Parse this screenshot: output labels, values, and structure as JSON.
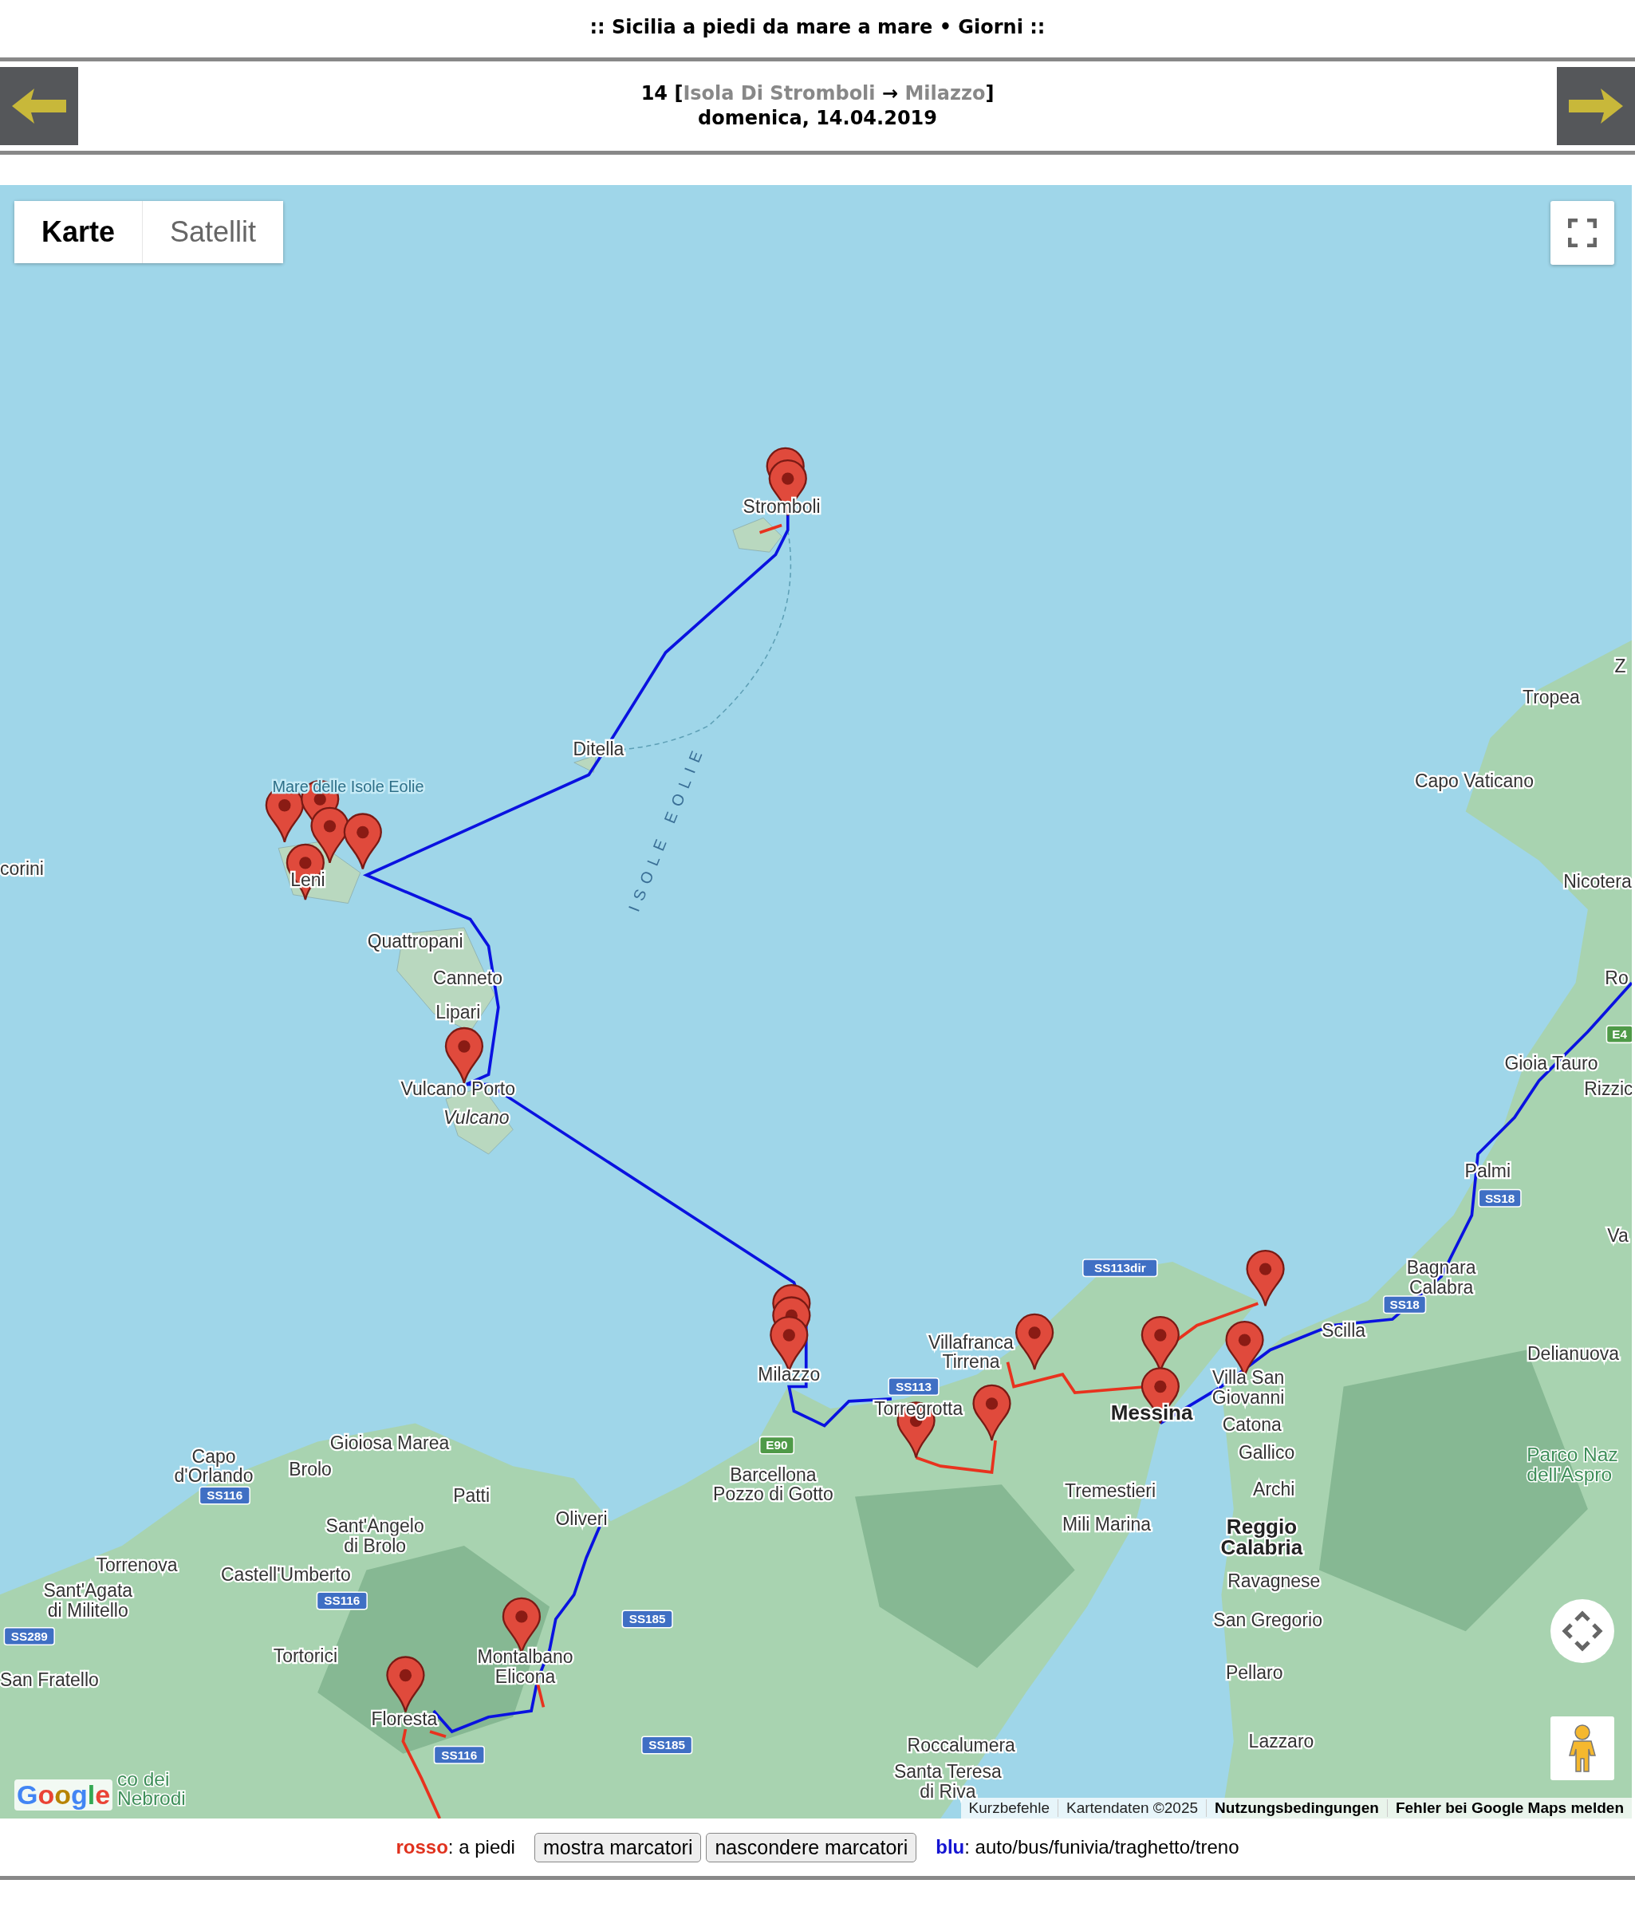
{
  "page_title": ":: Sicilia a piedi da mare a mare • Giorni ::",
  "day_nav": {
    "day_number": "14",
    "open_bracket": "[",
    "from": "Isola Di Stromboli",
    "arrow": "→",
    "to": "Milazzo",
    "close_bracket": "]",
    "date": "domenica, 14.04.2019"
  },
  "map": {
    "map_type_tabs": [
      {
        "label": "Karte",
        "selected": true
      },
      {
        "label": "Satellit",
        "selected": false
      }
    ],
    "labels": [
      {
        "lines": [
          "Stromboli"
        ],
        "kind": "place"
      },
      {
        "lines": [
          "Z"
        ],
        "kind": "place"
      },
      {
        "lines": [
          "Tropea"
        ],
        "kind": "place"
      },
      {
        "lines": [
          "Ditella"
        ],
        "kind": "place"
      },
      {
        "lines": [
          "Mare delle Isole Eolie"
        ],
        "kind": "water"
      },
      {
        "lines": [
          "Capo Vaticano"
        ],
        "kind": "place"
      },
      {
        "lines": [
          "ISOLE EOLIE"
        ],
        "kind": "archipelago"
      },
      {
        "lines": [
          "corini"
        ],
        "kind": "place"
      },
      {
        "lines": [
          "Leni"
        ],
        "kind": "place"
      },
      {
        "lines": [
          "Nicotera"
        ],
        "kind": "place"
      },
      {
        "lines": [
          "Quattropani"
        ],
        "kind": "place"
      },
      {
        "lines": [
          "Canneto"
        ],
        "kind": "place"
      },
      {
        "lines": [
          "Ro"
        ],
        "kind": "place"
      },
      {
        "lines": [
          "Lipari"
        ],
        "kind": "place"
      },
      {
        "lines": [
          "Gioia Tauro"
        ],
        "kind": "place"
      },
      {
        "lines": [
          "Vulcano Porto"
        ],
        "kind": "place"
      },
      {
        "lines": [
          "Rizzic"
        ],
        "kind": "place"
      },
      {
        "lines": [
          "Vulcano"
        ],
        "kind": "island"
      },
      {
        "lines": [
          "Palmi"
        ],
        "kind": "place"
      },
      {
        "lines": [
          "Va"
        ],
        "kind": "place"
      },
      {
        "lines": [
          "Bagnara",
          "Calabra"
        ],
        "kind": "place"
      },
      {
        "lines": [
          "Scilla"
        ],
        "kind": "place"
      },
      {
        "lines": [
          "Villafranca",
          "Tirrena"
        ],
        "kind": "place"
      },
      {
        "lines": [
          "Delianuova"
        ],
        "kind": "place"
      },
      {
        "lines": [
          "Milazzo"
        ],
        "kind": "place"
      },
      {
        "lines": [
          "Villa San",
          "Giovanni"
        ],
        "kind": "place"
      },
      {
        "lines": [
          "Torregrotta"
        ],
        "kind": "place"
      },
      {
        "lines": [
          "Messina"
        ],
        "kind": "city"
      },
      {
        "lines": [
          "Catona"
        ],
        "kind": "place"
      },
      {
        "lines": [
          "Gioiosa Marea"
        ],
        "kind": "place"
      },
      {
        "lines": [
          "Capo",
          "d'Orlando"
        ],
        "kind": "place"
      },
      {
        "lines": [
          "Brolo"
        ],
        "kind": "place"
      },
      {
        "lines": [
          "Gallico"
        ],
        "kind": "place"
      },
      {
        "lines": [
          "Patti"
        ],
        "kind": "place"
      },
      {
        "lines": [
          "Barcellona",
          "Pozzo di Gotto"
        ],
        "kind": "place"
      },
      {
        "lines": [
          "Tremestieri"
        ],
        "kind": "place"
      },
      {
        "lines": [
          "Archi"
        ],
        "kind": "place"
      },
      {
        "lines": [
          "Parco Naz",
          "dell'Aspro"
        ],
        "kind": "park"
      },
      {
        "lines": [
          "Sant'Angelo",
          "di Brolo"
        ],
        "kind": "place"
      },
      {
        "lines": [
          "Oliveri"
        ],
        "kind": "place"
      },
      {
        "lines": [
          "Mili Marina"
        ],
        "kind": "place"
      },
      {
        "lines": [
          "Reggio",
          "Calabria"
        ],
        "kind": "city"
      },
      {
        "lines": [
          "Torrenova"
        ],
        "kind": "place"
      },
      {
        "lines": [
          "Castell'Umberto"
        ],
        "kind": "place"
      },
      {
        "lines": [
          "Ravagnese"
        ],
        "kind": "place"
      },
      {
        "lines": [
          "Sant'Agata",
          "di Militello"
        ],
        "kind": "place"
      },
      {
        "lines": [
          "San Gregorio"
        ],
        "kind": "place"
      },
      {
        "lines": [
          "Tortorici"
        ],
        "kind": "place"
      },
      {
        "lines": [
          "Montalbano",
          "Elicona"
        ],
        "kind": "place"
      },
      {
        "lines": [
          "Pellaro"
        ],
        "kind": "place"
      },
      {
        "lines": [
          "San Fratello"
        ],
        "kind": "place"
      },
      {
        "lines": [
          "Floresta"
        ],
        "kind": "place"
      },
      {
        "lines": [
          "Roccalumera"
        ],
        "kind": "place"
      },
      {
        "lines": [
          "Lazzaro"
        ],
        "kind": "place"
      },
      {
        "lines": [
          "co dei",
          "Nebrodi"
        ],
        "kind": "park"
      },
      {
        "lines": [
          "Santa Teresa",
          "di Riva"
        ],
        "kind": "place"
      }
    ],
    "road_shields": [
      {
        "text": "SS113dir",
        "kind": "state"
      },
      {
        "text": "SS113",
        "kind": "state"
      },
      {
        "text": "E90",
        "kind": "european"
      },
      {
        "text": "SS116",
        "kind": "state"
      },
      {
        "text": "SS116",
        "kind": "state"
      },
      {
        "text": "SS116",
        "kind": "state"
      },
      {
        "text": "SS289",
        "kind": "state"
      },
      {
        "text": "SS185",
        "kind": "state"
      },
      {
        "text": "SS185",
        "kind": "state"
      },
      {
        "text": "SS18",
        "kind": "state"
      },
      {
        "text": "SS18",
        "kind": "state"
      },
      {
        "text": "E4",
        "kind": "european"
      }
    ],
    "logo": "Google",
    "attribution": [
      "Kurzbefehle",
      "Kartendaten ©2025",
      "Nutzungsbedingungen",
      "Fehler bei Google Maps melden"
    ]
  },
  "legend": {
    "walk_word": "rosso",
    "walk_text": ": a piedi",
    "buttons": [
      "mostra marcatori",
      "nascondere marcatori"
    ],
    "transport_word": "blu",
    "transport_text": ": auto/bus/funivia/traghetto/treno"
  }
}
